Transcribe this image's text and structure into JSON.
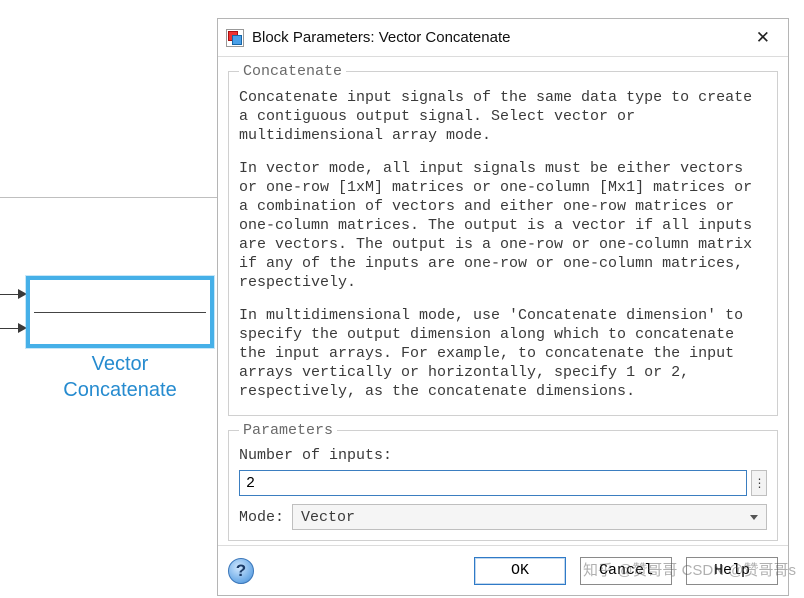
{
  "canvas": {
    "block_label_line1": "Vector",
    "block_label_line2": "Concatenate"
  },
  "dialog": {
    "title": "Block Parameters: Vector Concatenate",
    "groups": {
      "concat": {
        "legend": "Concatenate",
        "p1": "Concatenate input signals of the same data type to create a contiguous output signal. Select vector or multidimensional array mode.",
        "p2": "In vector mode, all input signals must be either vectors or one-row [1xM] matrices or one-column [Mx1] matrices or a combination of vectors and either one-row matrices or one-column matrices. The output is a vector if all inputs are vectors. The output is a one-row or one-column matrix if any of the inputs are one-row or one-column matrices, respectively.",
        "p3": "In multidimensional mode, use 'Concatenate dimension' to specify the output dimension along which to concatenate the input arrays. For example, to concatenate the input arrays vertically or horizontally, specify 1 or 2, respectively, as the concatenate dimensions."
      },
      "params": {
        "legend": "Parameters",
        "num_inputs_label": "Number of inputs:",
        "num_inputs_value": "2",
        "mode_label": "Mode:",
        "mode_value": "Vector"
      }
    },
    "buttons": {
      "ok": "OK",
      "cancel": "Cancel",
      "help": "Help"
    }
  },
  "watermark": "知乎 @赞哥哥  CSDN @赞哥哥s"
}
